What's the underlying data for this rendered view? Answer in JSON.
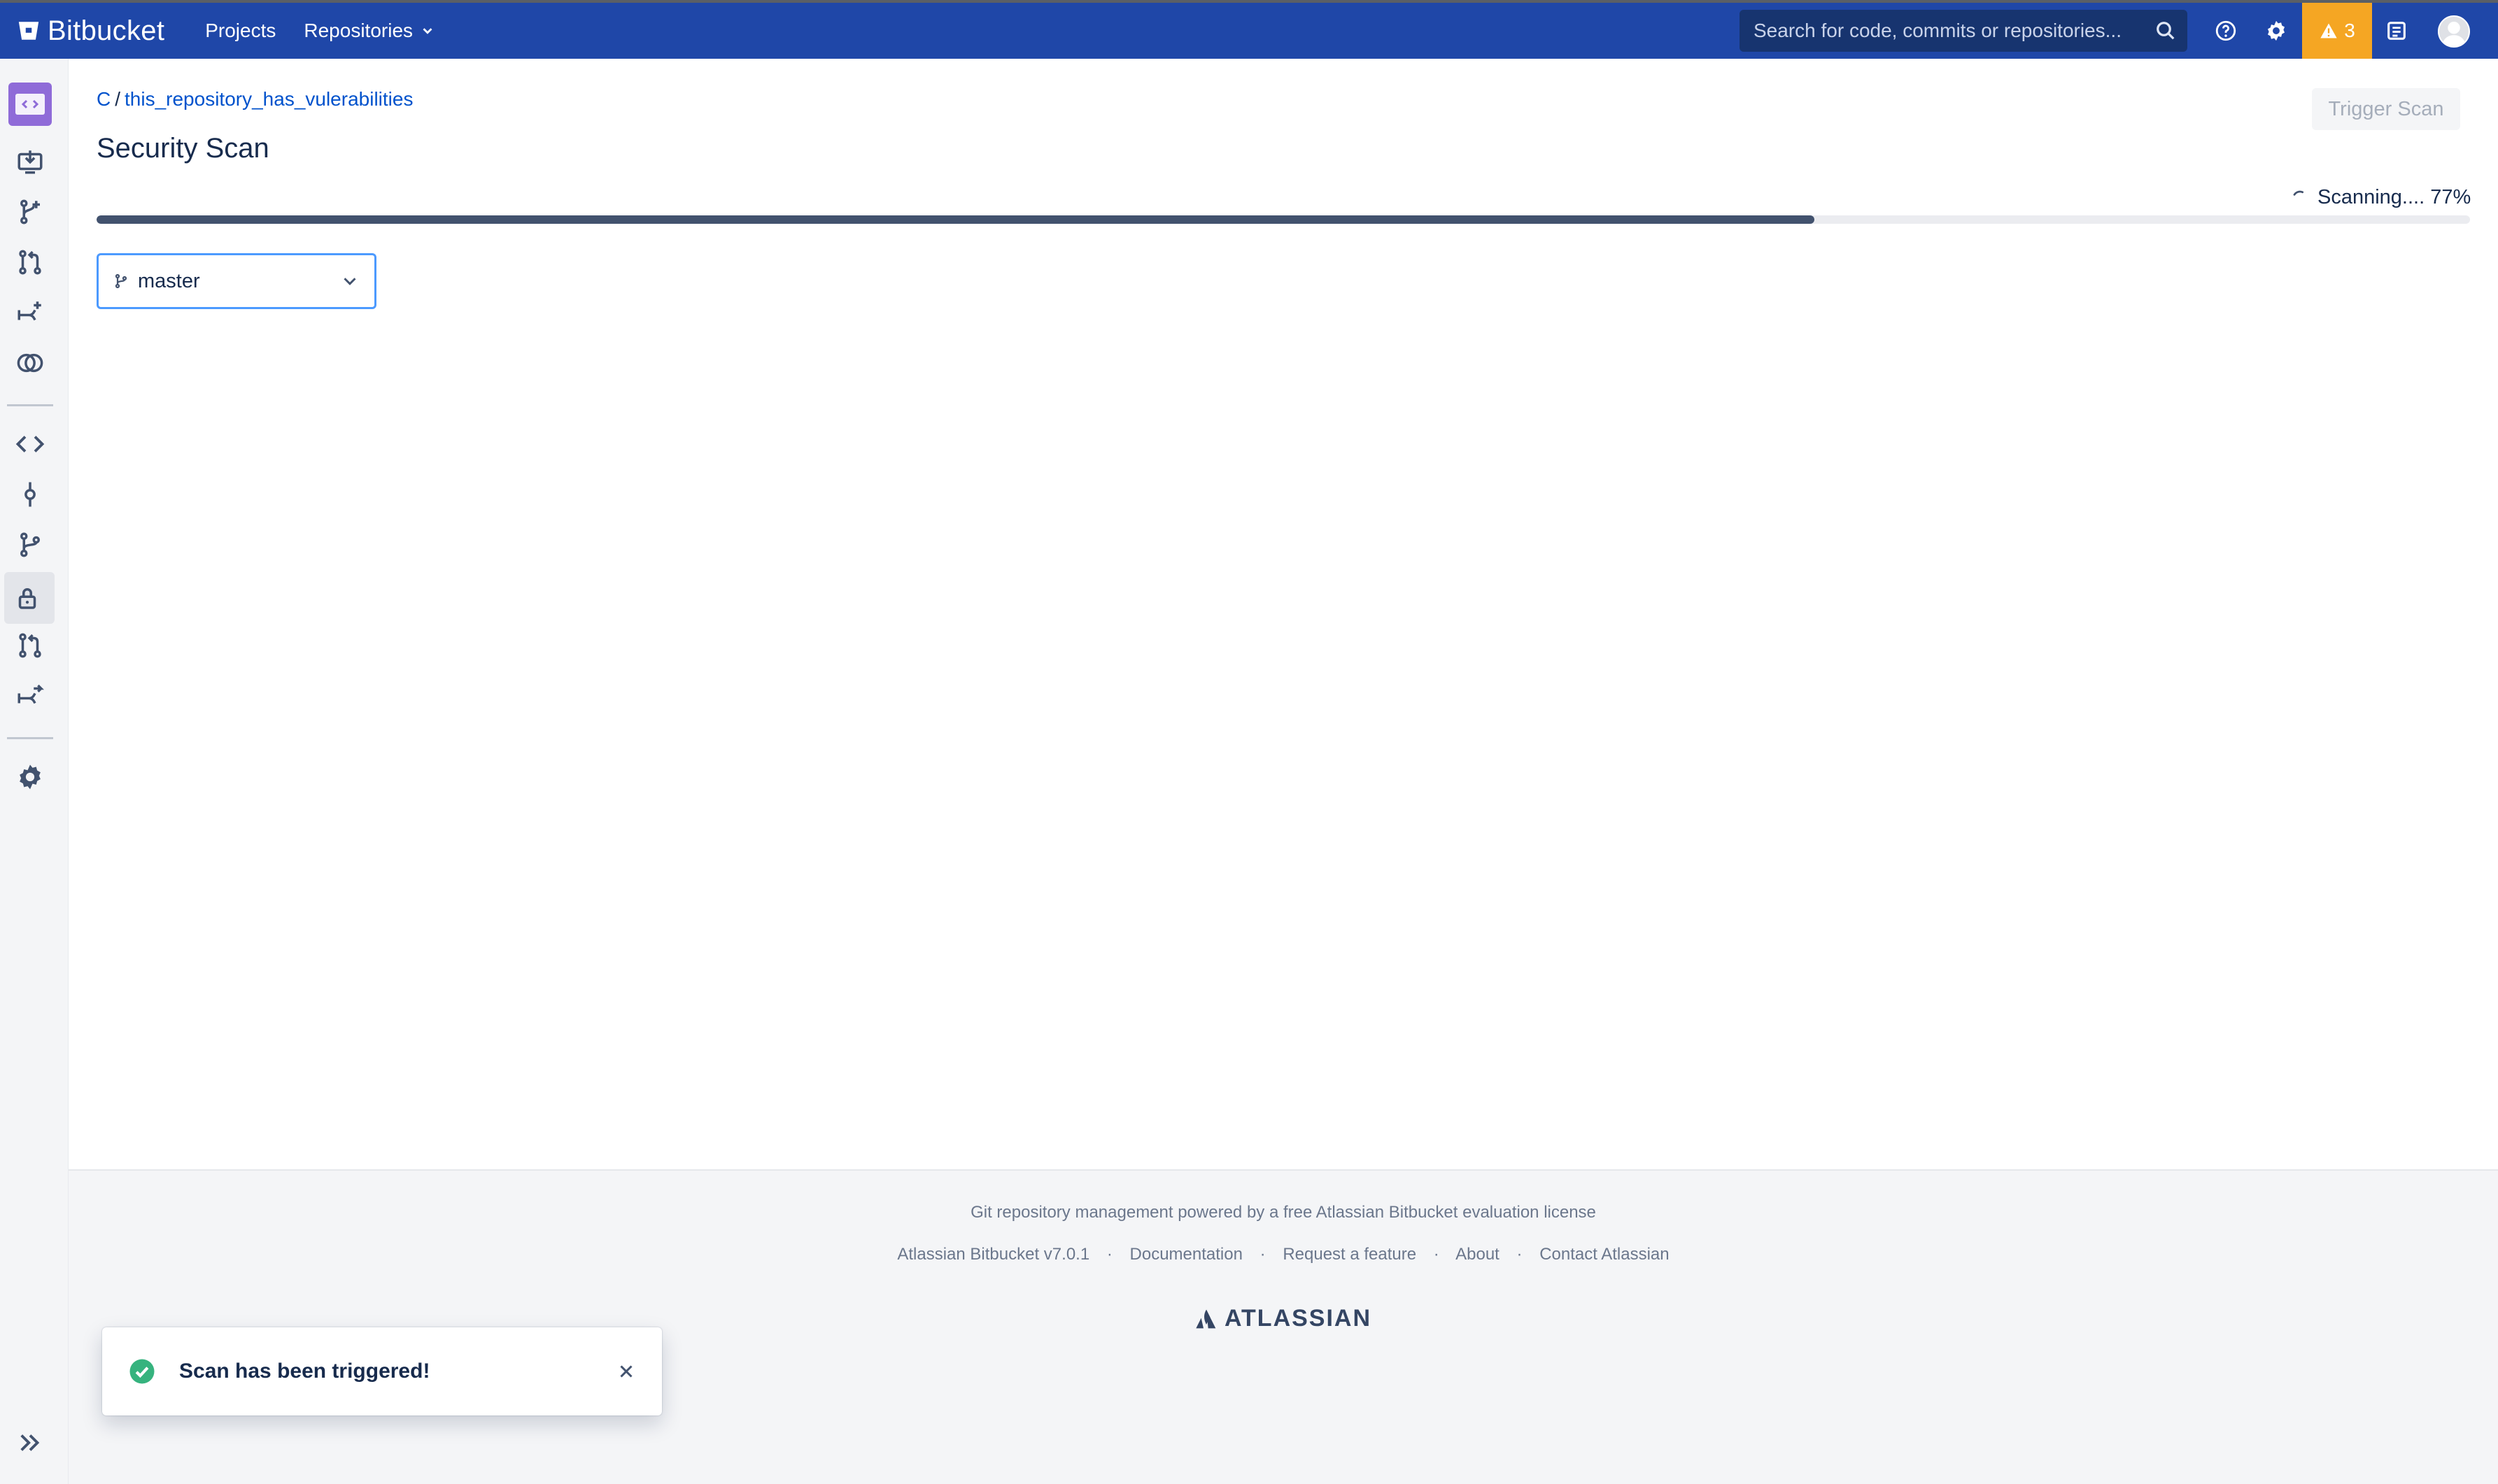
{
  "app": {
    "name": "Bitbucket"
  },
  "topbar": {
    "nav": [
      {
        "label": "Projects"
      },
      {
        "label": "Repositories"
      }
    ],
    "search_placeholder": "Search for code, commits or repositories...",
    "alerts_count": "3",
    "colors": {
      "bar": "#1f47a8",
      "alert": "#f5a623"
    }
  },
  "sidebar": {
    "icons": [
      "repository-avatar",
      "clone-icon",
      "create-branch-icon",
      "create-pull-request-icon",
      "fork-icon",
      "compare-icon",
      "source-icon",
      "commits-icon",
      "branches-icon",
      "security-lock-icon",
      "pull-requests-icon",
      "forks-icon",
      "settings-icon",
      "expand-sidebar-icon"
    ]
  },
  "breadcrumb": {
    "project": "C",
    "separator": "/",
    "repository": "this_repository_has_vulerabilities"
  },
  "page": {
    "title": "Security Scan",
    "trigger_button": "Trigger Scan",
    "scan_status": "Scanning.... 77%",
    "progress": 0.77,
    "branch": "master"
  },
  "footer": {
    "license": "Git repository management powered by a free Atlassian Bitbucket evaluation license",
    "links": [
      "Atlassian Bitbucket v7.0.1",
      "Documentation",
      "Request a feature",
      "About",
      "Contact Atlassian"
    ],
    "brand": "ATLASSIAN"
  },
  "flag": {
    "message": "Scan has been triggered!",
    "color": "#36b37e"
  }
}
